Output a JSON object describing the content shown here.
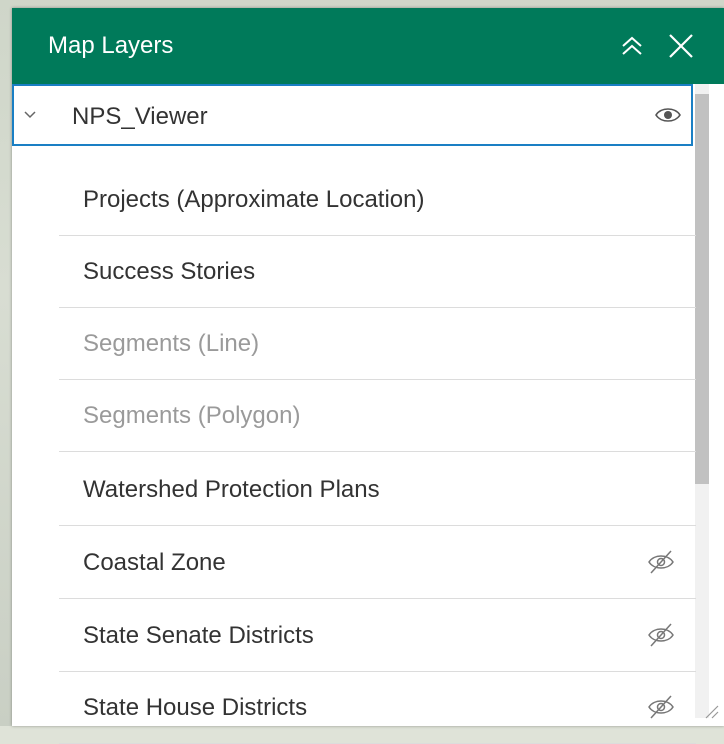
{
  "panel": {
    "title": "Map Layers",
    "header_color": "#007a5a",
    "icons": {
      "collapse": "double-chevron-up-icon",
      "close": "close-icon"
    }
  },
  "layers": {
    "parent": {
      "label": "NPS_Viewer",
      "expanded": true,
      "visible": true
    },
    "children": [
      {
        "label": "Projects (Approximate Location)",
        "dimmed": false,
        "hidden": false
      },
      {
        "label": "Success Stories",
        "dimmed": false,
        "hidden": false
      },
      {
        "label": "Segments (Line)",
        "dimmed": true,
        "hidden": false
      },
      {
        "label": "Segments (Polygon)",
        "dimmed": true,
        "hidden": false
      },
      {
        "label": "Watershed Protection Plans",
        "dimmed": false,
        "hidden": false
      },
      {
        "label": "Coastal Zone",
        "dimmed": false,
        "hidden": true
      },
      {
        "label": "State Senate Districts",
        "dimmed": false,
        "hidden": true
      },
      {
        "label": "State House Districts",
        "dimmed": false,
        "hidden": true
      }
    ]
  }
}
